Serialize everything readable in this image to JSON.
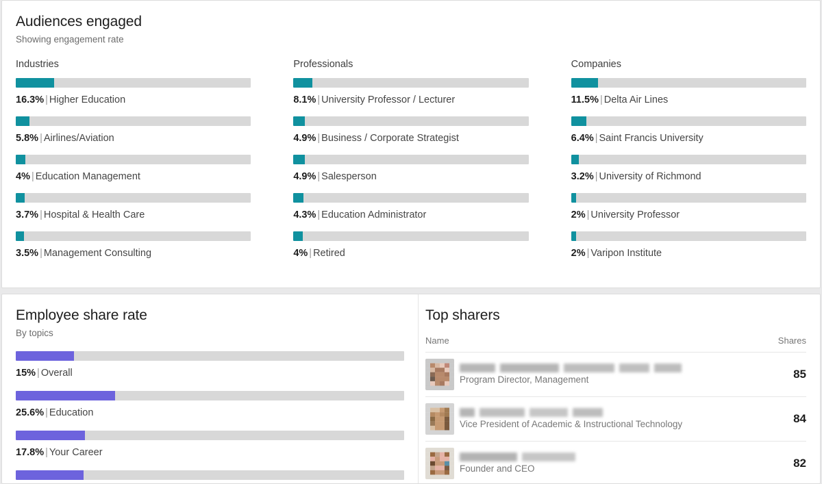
{
  "audiences": {
    "title": "Audiences engaged",
    "subtitle": "Showing engagement rate",
    "bar_color": "#10919f",
    "track_color": "#d8d8d8",
    "columns": [
      {
        "title": "Industries",
        "items": [
          {
            "value": "16.3%",
            "pct": 16.3,
            "label": "Higher Education"
          },
          {
            "value": "5.8%",
            "pct": 5.8,
            "label": "Airlines/Aviation"
          },
          {
            "value": "4%",
            "pct": 4.0,
            "label": "Education Management"
          },
          {
            "value": "3.7%",
            "pct": 3.7,
            "label": "Hospital & Health Care"
          },
          {
            "value": "3.5%",
            "pct": 3.5,
            "label": "Management Consulting"
          }
        ]
      },
      {
        "title": "Professionals",
        "items": [
          {
            "value": "8.1%",
            "pct": 8.1,
            "label": "University Professor / Lecturer"
          },
          {
            "value": "4.9%",
            "pct": 4.9,
            "label": "Business / Corporate Strategist"
          },
          {
            "value": "4.9%",
            "pct": 4.9,
            "label": "Salesperson"
          },
          {
            "value": "4.3%",
            "pct": 4.3,
            "label": "Education Administrator"
          },
          {
            "value": "4%",
            "pct": 4.0,
            "label": "Retired"
          }
        ]
      },
      {
        "title": "Companies",
        "items": [
          {
            "value": "11.5%",
            "pct": 11.5,
            "label": "Delta Air Lines"
          },
          {
            "value": "6.4%",
            "pct": 6.4,
            "label": "Saint Francis University"
          },
          {
            "value": "3.2%",
            "pct": 3.2,
            "label": "University of Richmond"
          },
          {
            "value": "2%",
            "pct": 2.0,
            "label": "University Professor"
          },
          {
            "value": "2%",
            "pct": 2.0,
            "label": "Varipon Institute"
          }
        ]
      }
    ]
  },
  "employee_share": {
    "title": "Employee share rate",
    "subtitle": "By topics",
    "bar_color": "#6d63dd",
    "items": [
      {
        "value": "15%",
        "pct": 15.0,
        "label": "Overall"
      },
      {
        "value": "25.6%",
        "pct": 25.6,
        "label": "Education"
      },
      {
        "value": "17.8%",
        "pct": 17.8,
        "label": "Your Career"
      },
      {
        "value": "",
        "pct": 17.5,
        "label": ""
      }
    ]
  },
  "top_sharers": {
    "title": "Top sharers",
    "col_name": "Name",
    "col_shares": "Shares",
    "rows": [
      {
        "name": "",
        "name_redacted": true,
        "title": "Program Director, Management",
        "shares": "85"
      },
      {
        "name": "",
        "name_redacted": true,
        "title": "Vice President of Academic & Instructional Technology",
        "shares": "84"
      },
      {
        "name": "",
        "name_redacted": true,
        "title": "Founder and CEO",
        "shares": "82"
      }
    ]
  },
  "chart_data": [
    {
      "type": "bar",
      "title": "Audiences engaged — Industries",
      "subtitle": "Showing engagement rate",
      "orientation": "horizontal",
      "categories": [
        "Higher Education",
        "Airlines/Aviation",
        "Education Management",
        "Hospital & Health Care",
        "Management Consulting"
      ],
      "values": [
        16.3,
        5.8,
        4.0,
        3.7,
        3.5
      ],
      "xlabel": "Engagement rate (%)",
      "ylabel": "",
      "xlim": [
        0,
        100
      ],
      "grid": false,
      "legend": "none"
    },
    {
      "type": "bar",
      "title": "Audiences engaged — Professionals",
      "subtitle": "Showing engagement rate",
      "orientation": "horizontal",
      "categories": [
        "University Professor / Lecturer",
        "Business / Corporate Strategist",
        "Salesperson",
        "Education Administrator",
        "Retired"
      ],
      "values": [
        8.1,
        4.9,
        4.9,
        4.3,
        4.0
      ],
      "xlabel": "Engagement rate (%)",
      "ylabel": "",
      "xlim": [
        0,
        100
      ],
      "grid": false,
      "legend": "none"
    },
    {
      "type": "bar",
      "title": "Audiences engaged — Companies",
      "subtitle": "Showing engagement rate",
      "orientation": "horizontal",
      "categories": [
        "Delta Air Lines",
        "Saint Francis University",
        "University of Richmond",
        "University Professor",
        "Varipon Institute"
      ],
      "values": [
        11.5,
        6.4,
        3.2,
        2.0,
        2.0
      ],
      "xlabel": "Engagement rate (%)",
      "ylabel": "",
      "xlim": [
        0,
        100
      ],
      "grid": false,
      "legend": "none"
    },
    {
      "type": "bar",
      "title": "Employee share rate",
      "subtitle": "By topics",
      "orientation": "horizontal",
      "categories": [
        "Overall",
        "Education",
        "Your Career"
      ],
      "values": [
        15.0,
        25.6,
        17.8
      ],
      "xlabel": "Share rate (%)",
      "ylabel": "",
      "xlim": [
        0,
        100
      ],
      "grid": false,
      "legend": "none"
    },
    {
      "type": "table",
      "title": "Top sharers",
      "columns": [
        "Name",
        "Shares"
      ],
      "rows": [
        [
          "Program Director, Management",
          85
        ],
        [
          "Vice President of Academic & Instructional Technology",
          84
        ],
        [
          "Founder and CEO",
          82
        ]
      ]
    }
  ]
}
